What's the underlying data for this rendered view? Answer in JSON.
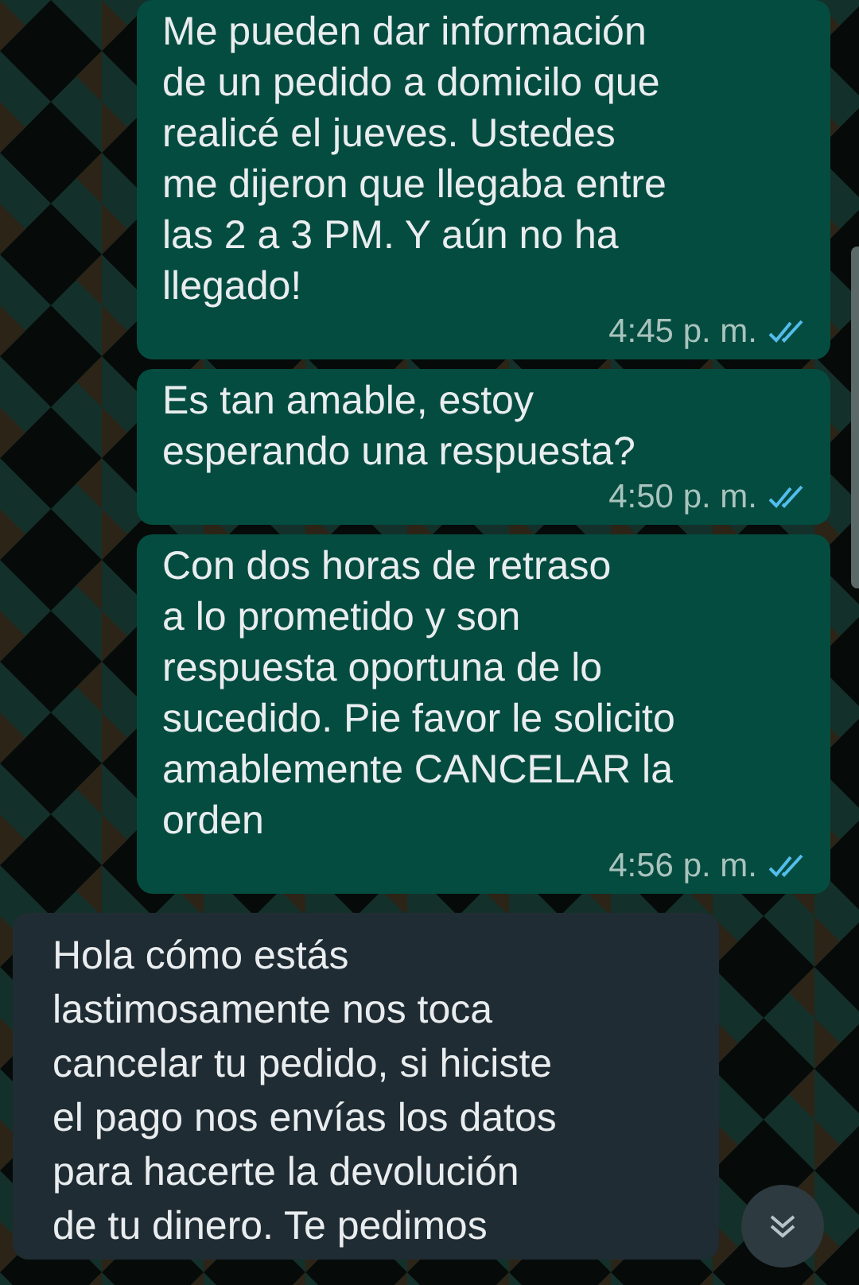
{
  "messages": [
    {
      "kind": "outgoing",
      "text": "Me pueden dar información\nde un pedido a domicilo que\nrealicé el jueves. Ustedes\nme dijeron que llegaba entre\nlas 2 a 3 PM. Y aún no ha\nllegado!",
      "time": "4:45 p. m.",
      "read": true
    },
    {
      "kind": "outgoing",
      "text": "Es tan amable, estoy\nesperando una respuesta?",
      "time": "4:50 p. m.",
      "read": true
    },
    {
      "kind": "outgoing",
      "text": "Con dos horas de retraso\na lo prometido y son\nrespuesta oportuna de lo\nsucedido. Pie favor le solicito\namablemente CANCELAR la\norden",
      "time": "4:56 p. m.",
      "read": true
    },
    {
      "kind": "incoming",
      "text": "Hola cómo estás\nlastimosamente nos toca\ncancelar tu pedido, si hiciste\nel pago nos envías los datos\npara hacerte la devolución\nde tu dinero. Te pedimos"
    }
  ]
}
